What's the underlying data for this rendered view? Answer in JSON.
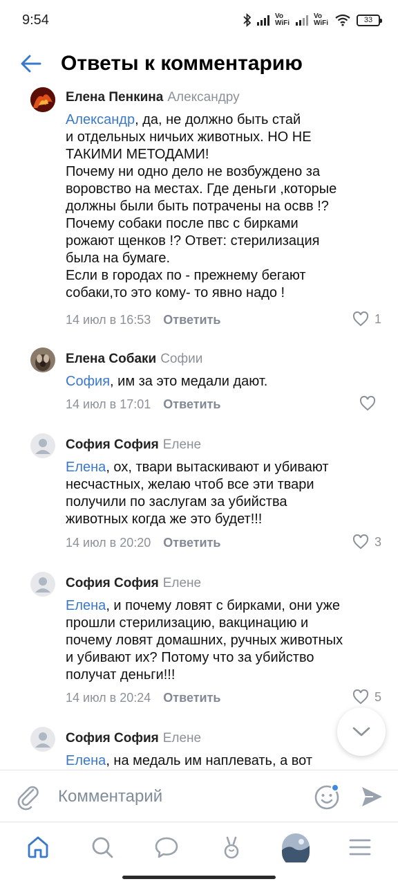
{
  "status_bar": {
    "time": "9:54",
    "network_label_1": "Vo WiFi",
    "network_label_2": "Vo WiFi",
    "battery": "33"
  },
  "header": {
    "title": "Ответы к комментарию",
    "back_icon": "arrow-left-icon"
  },
  "comments": [
    {
      "author": "Елена Пенкина",
      "reply_to": "Александру",
      "mention": "Александр",
      "text": ", да, не должно быть стай\nи отдельных ничьих животных. НО НЕ\nТАКИМИ МЕТОДАМИ!\nПочему ни одно дело не возбуждено за\nворовство на местах. Где деньги ,которые\nдолжны были быть потрачены на освв !?\nПочему собаки после пвс с бирками\nрожают щенков !? Ответ: стерилизация\nбыла на бумаге.\nЕсли в городах по - прежнему бегают\nсобаки,то это кому- то явно надо !",
      "date": "14 июл в 16:53",
      "reply_label": "Ответить",
      "likes": "1"
    },
    {
      "author": "Елена Собаки",
      "reply_to": "Софии",
      "mention": "София",
      "text": ", им за это медали дают.",
      "date": "14 июл в 17:01",
      "reply_label": "Ответить",
      "likes": ""
    },
    {
      "author": "София София",
      "reply_to": "Елене",
      "mention": "Елена",
      "text": ", ох, твари вытаскивают и убивают\nнесчастных, желаю чтоб все эти твари\nполучили по заслугам за убийства\nживотных когда же это будет!!!",
      "date": "14 июл в 20:20",
      "reply_label": "Ответить",
      "likes": "3"
    },
    {
      "author": "София София",
      "reply_to": "Елене",
      "mention": "Елена",
      "text": ", и почему ловят с бирками, они уже\nпрошли стерилизацию, вакцинацию и\nпочему ловят домашних, ручных животных\nи убивают их? Потому что за убийство\nполучат деньги!!!",
      "date": "14 июл в 20:24",
      "reply_label": "Ответить",
      "likes": "5"
    },
    {
      "author": "София София",
      "reply_to": "Елене",
      "mention": "Елена",
      "text": ", на медаль им наплевать, а вот"
    }
  ],
  "composer": {
    "placeholder": "Комментарий"
  },
  "tabbar": {
    "items": [
      "home-icon",
      "search-icon",
      "messages-icon",
      "clips-icon",
      "profile-avatar",
      "menu-icon"
    ]
  },
  "colors": {
    "accent": "#3a78c9",
    "secondary_text": "#8c9199"
  }
}
